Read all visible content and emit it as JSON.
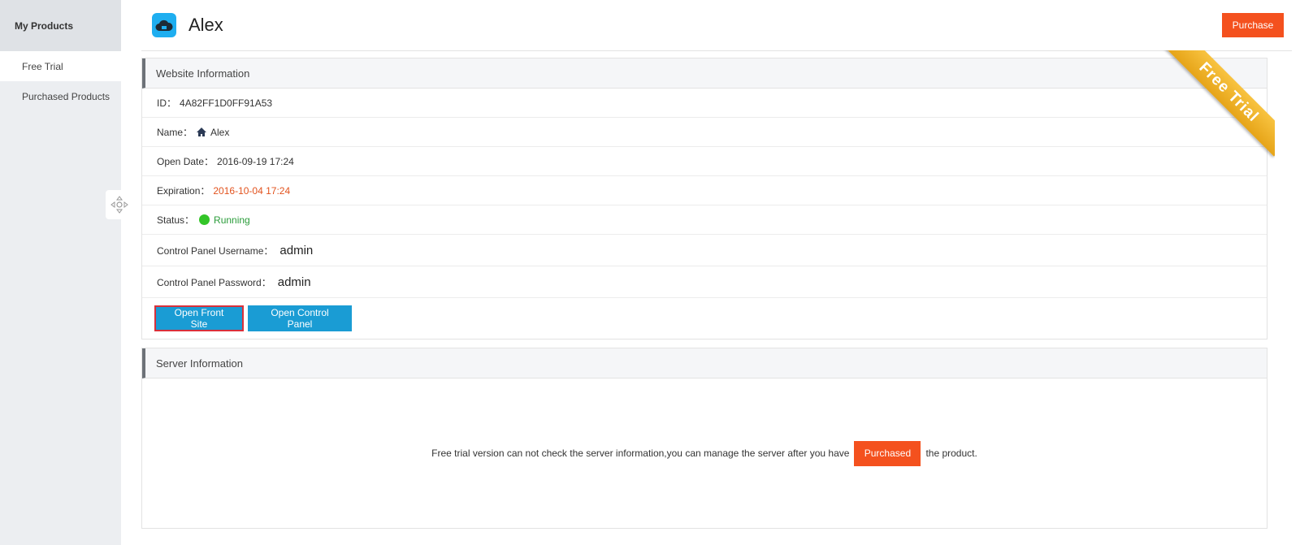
{
  "sidebar": {
    "title": "My Products",
    "items": [
      {
        "label": "Free Trial",
        "active": true
      },
      {
        "label": "Purchased Products",
        "active": false
      }
    ]
  },
  "header": {
    "title": "Alex",
    "purchase_label": "Purchase",
    "icon": "cloud-icon"
  },
  "website": {
    "section_title": "Website Information",
    "ribbon": "Free Trial",
    "id_label": "ID：",
    "id_value": "4A82FF1D0FF91A53",
    "name_label": "Name：",
    "name_value": "Alex",
    "open_date_label": "Open Date：",
    "open_date_value": "2016-09-19 17:24",
    "expiration_label": "Expiration：",
    "expiration_value": "2016-10-04 17:24",
    "status_label": "Status：",
    "status_value": "Running",
    "cp_user_label": "Control Panel Username：",
    "cp_user_value": "admin",
    "cp_pass_label": "Control Panel Password：",
    "cp_pass_value": "admin",
    "open_front_label": "Open Front Site",
    "open_cp_label": "Open Control Panel"
  },
  "server": {
    "section_title": "Server Information",
    "message_before": "Free trial version can not check the server information,you can manage the server after you have",
    "purchased_label": "Purchased",
    "message_after": "the product."
  },
  "colors": {
    "accent_orange": "#f4511e",
    "button_blue": "#1a9cd4",
    "status_green": "#33c528",
    "expiration_red": "#e2531e",
    "ribbon_gold": "#f0b22a"
  }
}
